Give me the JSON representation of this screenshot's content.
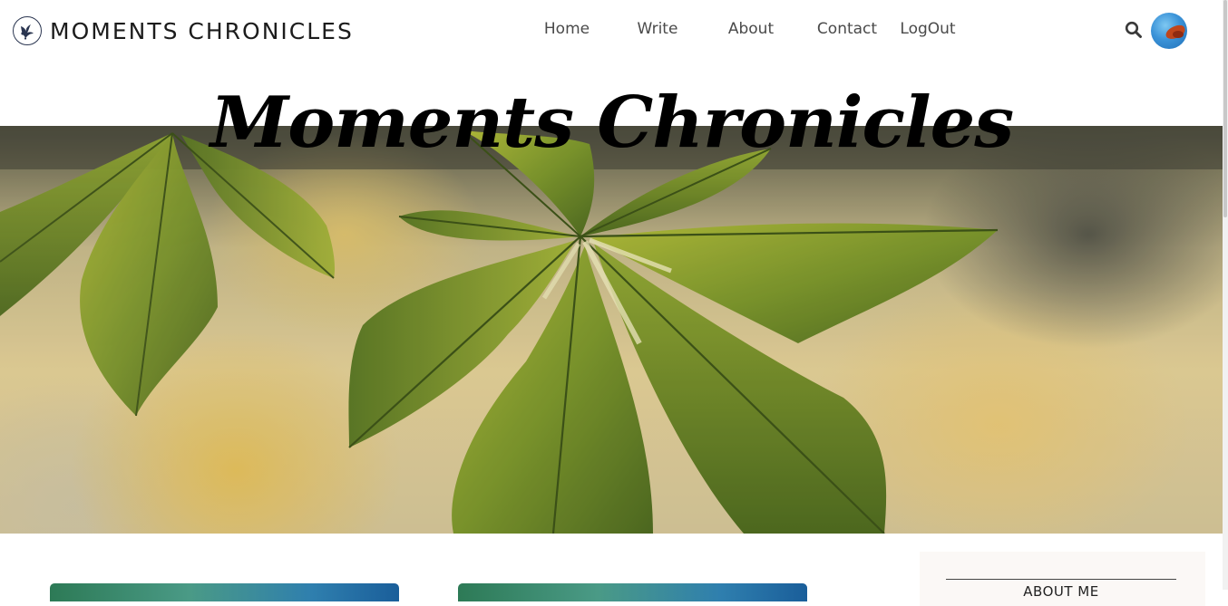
{
  "header": {
    "brand_title": "MOMENTS CHRONICLES",
    "logo_icon": "bird-logo-icon",
    "nav": [
      {
        "label": "Home"
      },
      {
        "label": "Write"
      },
      {
        "label": "About"
      },
      {
        "label": "Contact"
      },
      {
        "label": "LogOut"
      }
    ],
    "search_icon": "search-icon",
    "avatar_icon": "profile-avatar"
  },
  "hero": {
    "title": "Moments Chronicles",
    "image": "green-chestnut-leaves-photo"
  },
  "posts": [
    {
      "image": "post-thumbnail-1"
    },
    {
      "image": "post-thumbnail-2"
    }
  ],
  "sidebar": {
    "title": "ABOUT ME"
  },
  "colors": {
    "brand_text": "#1c1c1c",
    "nav_text": "#4a4a4a",
    "sidebar_bg": "#fbf8f6",
    "leaf_green": "#7f9a2c"
  }
}
